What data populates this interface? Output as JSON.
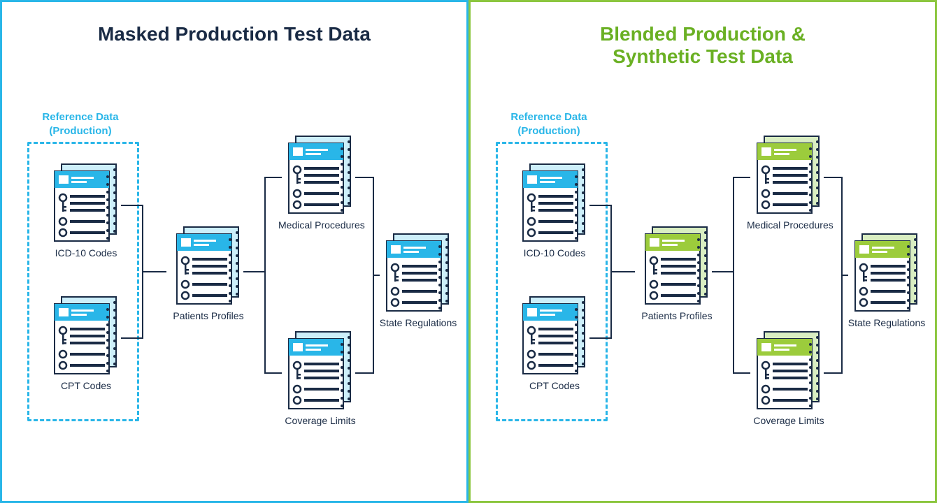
{
  "panels": [
    {
      "title": "Masked Production Test Data",
      "ref_label": "Reference Data\n(Production)",
      "scheme": "blue",
      "nodes": {
        "icd": {
          "label": "ICD-10 Codes",
          "color": "blue"
        },
        "cpt": {
          "label": "CPT Codes",
          "color": "blue"
        },
        "pat": {
          "label": "Patients Profiles",
          "color": "blue"
        },
        "med": {
          "label": "Medical Procedures",
          "color": "blue"
        },
        "cov": {
          "label": "Coverage Limits",
          "color": "blue"
        },
        "state": {
          "label": "State Regulations",
          "color": "blue"
        }
      }
    },
    {
      "title": "Blended Production & Synthetic Test Data",
      "ref_label": "Reference Data\n(Production)",
      "scheme": "green",
      "nodes": {
        "icd": {
          "label": "ICD-10 Codes",
          "color": "blue"
        },
        "cpt": {
          "label": "CPT Codes",
          "color": "blue"
        },
        "pat": {
          "label": "Patients Profiles",
          "color": "green"
        },
        "med": {
          "label": "Medical Procedures",
          "color": "green"
        },
        "cov": {
          "label": "Coverage Limits",
          "color": "green"
        },
        "state": {
          "label": "State Regulations",
          "color": "green"
        }
      }
    }
  ]
}
